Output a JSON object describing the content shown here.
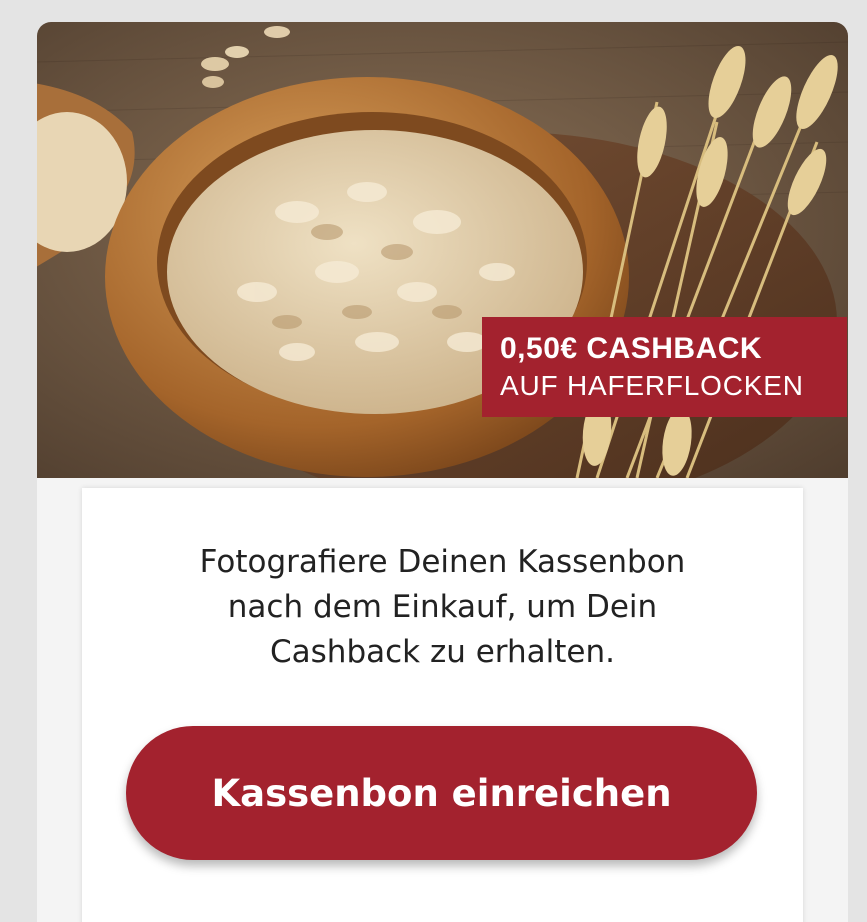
{
  "hero": {
    "image_alt_icon": "oat-flakes-bowl-wheat-image",
    "badge": {
      "line1": "0,50€ CASHBACK",
      "line2": "AUF HAFERFLOCKEN",
      "color": "#a3222e"
    }
  },
  "panel": {
    "description_lines": [
      "Fotografiere Deinen Kassenbon",
      "nach dem Einkauf, um Dein",
      "Cashback zu erhalten."
    ],
    "cta_label": "Kassenbon einreichen",
    "cta_color": "#a3222e"
  }
}
